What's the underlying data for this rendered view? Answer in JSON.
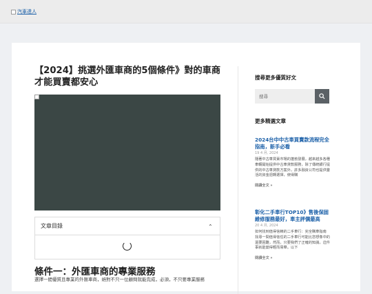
{
  "header": {
    "logo_alt": "汽車達人"
  },
  "post": {
    "title": "【2024】挑選外匯車商的5個條件》對的車商才能買賣都安心",
    "toc_label": "文章目錄",
    "section_heading": "條件一：外匯車商的專業服務",
    "section_text": "選擇一間優質且專業的外匯車商，絕對不只一位顧問就能完成，必須，不只要專業服務"
  },
  "sidebar": {
    "search_heading": "搜尋更多優質好文",
    "search_placeholder": "搜尋",
    "recent_heading": "更多精選文章",
    "articles": [
      {
        "title": "2024台中中古車買賣款流程完全指南，新手必看",
        "date": "19 4 月, 2024",
        "excerpt": "隨著中古車買賣市場的蓬勃發展，越來越多各種車輛開始提供中古車貸款服務，除了傳統銀行提供的中古車貸款方案外，許多融資公司也提供靈活的資金週轉選擇，使得購",
        "more": "閱讀全文 »"
      },
      {
        "title": "彰化二手車行TOP10》售後保固維修服務最好，車主評價最高",
        "date": "20 4 月, 2024",
        "excerpt": "如何找到值得信賴的二手車行：完全購車指南 找尋一間值得信任的二手車行可能比您想像中的還要困難，然而，只要我們了正確的知識，這件事就能變得輕而易舉。以下",
        "more": "閱讀全文 »"
      }
    ]
  },
  "colors": {
    "link": "#1a5fa8",
    "hero": "#3b4745",
    "search_button": "#5b6166"
  }
}
